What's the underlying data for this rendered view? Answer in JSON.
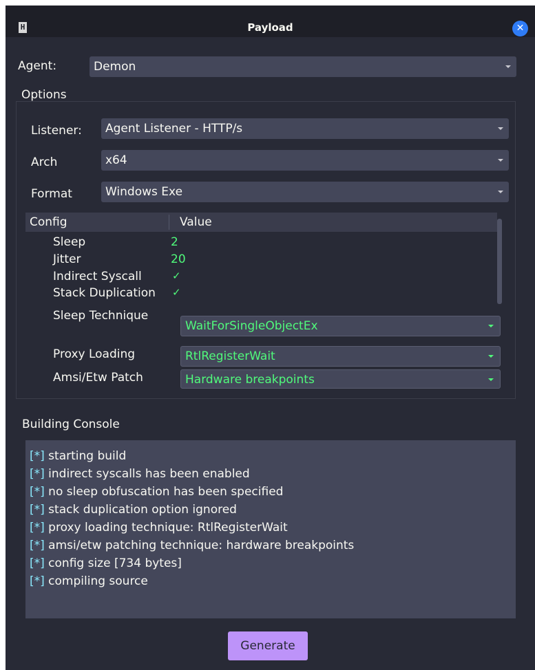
{
  "window": {
    "title": "Payload",
    "app_icon_glyph": "H",
    "close_glyph": "✕"
  },
  "agent": {
    "label": "Agent:",
    "value": "Demon"
  },
  "options": {
    "heading": "Options",
    "listener": {
      "label": "Listener:",
      "value": "Agent Listener - HTTP/s"
    },
    "arch": {
      "label": "Arch",
      "value": "x64"
    },
    "format": {
      "label": "Format",
      "value": "Windows Exe"
    }
  },
  "config_table": {
    "headers": [
      "Config",
      "Value"
    ],
    "rows": [
      {
        "label": "Sleep",
        "value": "2"
      },
      {
        "label": "Jitter",
        "value": "20"
      },
      {
        "label": "Indirect Syscall",
        "value": "✓"
      },
      {
        "label": "Stack Duplication",
        "value": "✓"
      },
      {
        "label": "Sleep Technique",
        "value": "WaitForSingleObjectEx"
      },
      {
        "label": "Proxy Loading",
        "value": "RtlRegisterWait"
      },
      {
        "label": "Amsi/Etw Patch",
        "value": "Hardware breakpoints"
      }
    ]
  },
  "console": {
    "heading": "Building Console",
    "prefix": "[*]",
    "lines": [
      "starting build",
      "indirect syscalls has been enabled",
      "no sleep obfuscation has been specified",
      "stack duplication option ignored",
      "proxy loading technique: RtlRegisterWait",
      "amsi/etw patching technique: hardware breakpoints",
      "config size [734 bytes]",
      "compiling source"
    ]
  },
  "actions": {
    "generate_label": "Generate"
  },
  "colors": {
    "background": "#282a36",
    "titlebar": "#1e1f27",
    "field": "#44475a",
    "value_green": "#50fa7b",
    "console_prefix": "#8be9fd",
    "generate_button": "#bd93f9",
    "close_button": "#2f7cf6"
  }
}
